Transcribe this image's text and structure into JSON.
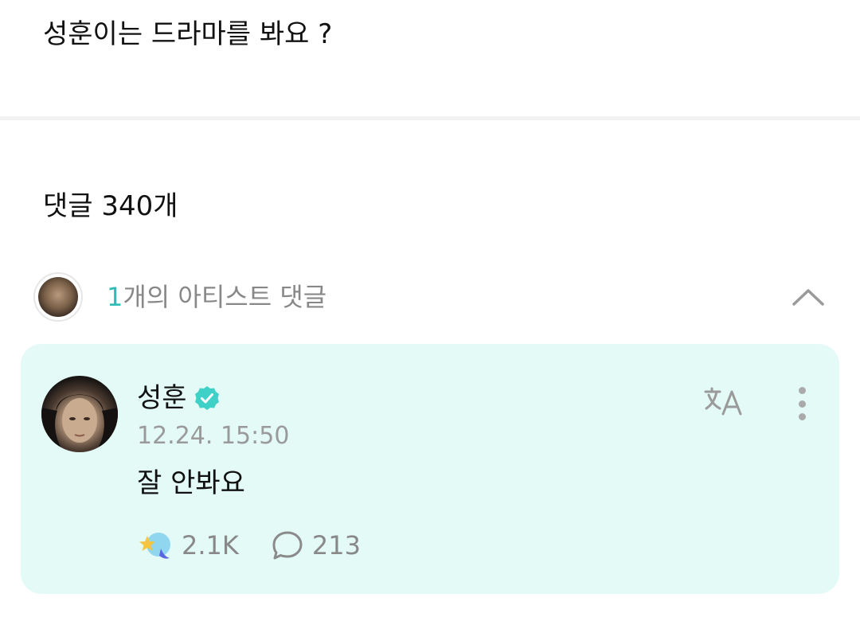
{
  "post": {
    "title": "성훈이는 드라마를 봐요 ?"
  },
  "comments_section": {
    "heading": "댓글 340개",
    "artist_comments": {
      "count": "1",
      "label": "개의 아티스트 댓글",
      "toggle_icon": "chevron-up-icon"
    }
  },
  "comment": {
    "author": "성훈",
    "verified_icon": "verified-badge-icon",
    "timestamp": "12.24. 15:50",
    "text": "잘 안봐요",
    "translate_icon": "translate-icon",
    "more_icon": "more-vertical-icon",
    "reaction_icon": "star-moon-reaction-icon",
    "reaction_count": "2.1K",
    "reply_icon": "speech-bubble-icon",
    "reply_count": "213"
  },
  "colors": {
    "accent": "#2bbdb6",
    "card_background": "#e4faf7",
    "muted_text": "#888888"
  }
}
